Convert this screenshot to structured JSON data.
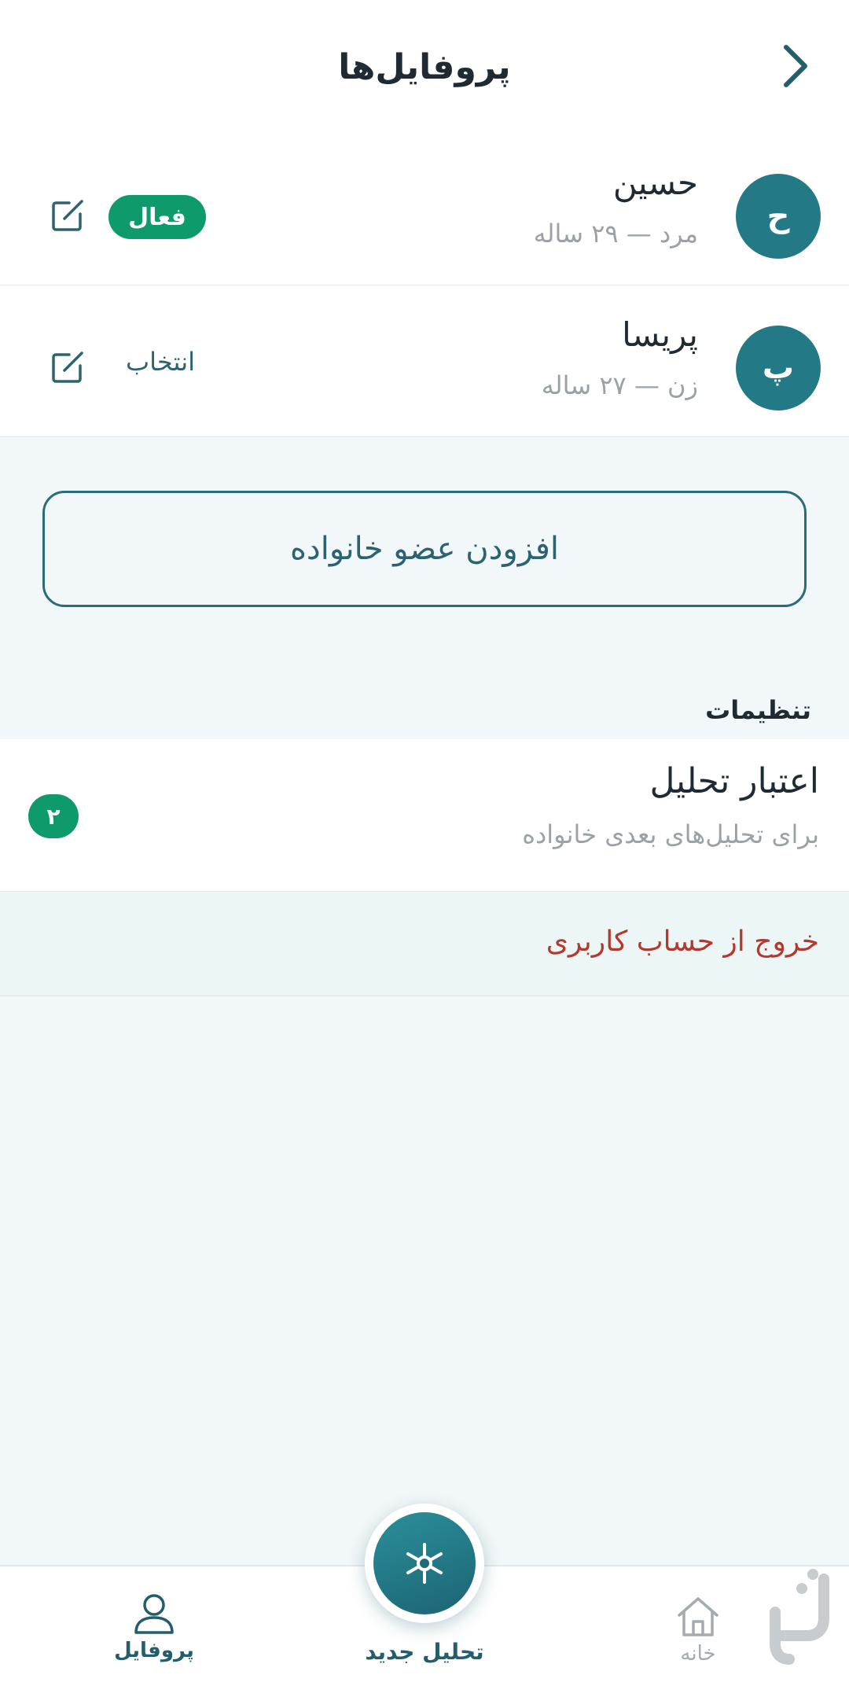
{
  "header": {
    "title": "پروفایل‌ها"
  },
  "profiles": [
    {
      "initial": "ح",
      "name": "حسین",
      "meta": "مرد — ۲۹ ساله",
      "status": "فعال"
    },
    {
      "initial": "پ",
      "name": "پریسا",
      "meta": "زن — ۲۷ ساله",
      "action": "انتخاب"
    }
  ],
  "add_family": {
    "label": "افزودن عضو خانواده"
  },
  "settings": {
    "title": "تنظیمات",
    "credit": {
      "title": "اعتبار تحلیل",
      "subtitle": "برای تحلیل‌های بعدی خانواده",
      "count": "۲"
    },
    "logout": "خروج از حساب کاربری"
  },
  "nav": {
    "profile": "پروفایل",
    "new_analysis": "تحلیل جدید",
    "home": "خانه"
  },
  "colors": {
    "primary": "#237a86",
    "success": "#0f9a6c",
    "danger": "#b3382e",
    "background": "#f2f7f9"
  },
  "icons": {
    "back": "chevron-right-icon",
    "edit": "edit-icon",
    "profile": "user-icon",
    "home": "home-icon",
    "new_analysis": "asterisk-icon"
  }
}
